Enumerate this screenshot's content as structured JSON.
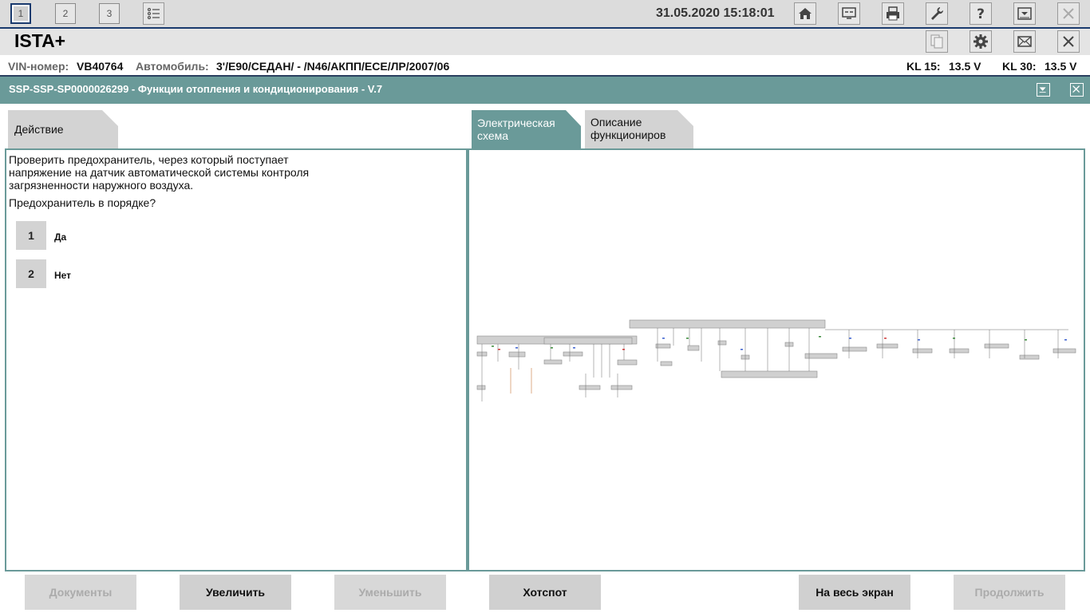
{
  "topbar": {
    "tabs": [
      "1",
      "2",
      "3"
    ],
    "datetime": "31.05.2020 15:18:01"
  },
  "app": {
    "title": "ISTA+"
  },
  "vehicle": {
    "vin_label": "VIN-номер:",
    "vin_value": "VB40764",
    "car_label": "Автомобиль:",
    "car_value": "3'/E90/СЕДАН/ - /N46/АКПП/ECE/ЛР/2007/06",
    "kl15_label": "KL 15:",
    "kl15_value": "13.5 V",
    "kl30_label": "KL 30:",
    "kl30_value": "13.5 V"
  },
  "document": {
    "title": "SSP-SSP-SP0000026299 - Функции отопления и кондиционирования - V.7"
  },
  "left_tab": {
    "label": "Действие"
  },
  "right_tabs": {
    "schematic": "Электрическая схема",
    "description": "Описание функциониров"
  },
  "question": {
    "line1": "Проверить предохранитель, через который поступает",
    "line2": "напряжение на датчик автоматической системы контроля",
    "line3": "загрязненности наружного воздуха.",
    "prompt": "Предохранитель в порядке?",
    "answers": [
      {
        "num": "1",
        "label": "Да"
      },
      {
        "num": "2",
        "label": "Нет"
      }
    ]
  },
  "bottom": {
    "documents": "Документы",
    "zoom_in": "Увеличить",
    "zoom_out": "Уменьшить",
    "hotspot": "Хотспот",
    "fullscreen": "На весь экран",
    "continue": "Продолжить"
  },
  "icons": {
    "top": [
      "home-icon",
      "swap-icon",
      "print-icon",
      "wrench-icon",
      "help-icon",
      "dropdown-icon",
      "close-icon"
    ],
    "second": [
      "documents-icon",
      "gear-icon",
      "mail-icon",
      "close-icon"
    ]
  },
  "colors": {
    "teal": "#6a9a99",
    "navy": "#1a3a6e",
    "disabled_text": "#ababab"
  }
}
